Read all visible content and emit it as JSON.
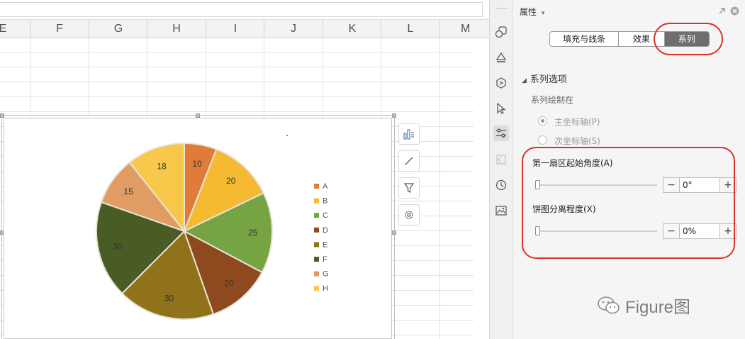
{
  "columns": [
    "E",
    "F",
    "G",
    "H",
    "I",
    "J",
    "K",
    "L",
    "M"
  ],
  "chart_data": {
    "type": "pie",
    "labels": [
      "A",
      "B",
      "C",
      "D",
      "E",
      "F",
      "G",
      "H"
    ],
    "values": [
      10,
      20,
      25,
      20,
      30,
      30,
      15,
      18
    ],
    "data_labels": [
      "10",
      "20",
      "25",
      "20",
      "30",
      "30",
      "15",
      "18"
    ],
    "colors": [
      "#e07b39",
      "#f5ba32",
      "#77a443",
      "#8e4a1e",
      "#8f7219",
      "#4a5c26",
      "#e09c63",
      "#f7c84a"
    ],
    "legend_position": "right",
    "start_angle_deg": 0
  },
  "chart_tools": [
    {
      "name": "chart-elements-icon"
    },
    {
      "name": "chart-style-icon"
    },
    {
      "name": "chart-filter-icon"
    },
    {
      "name": "chart-settings-icon"
    }
  ],
  "panel": {
    "title": "属性",
    "tabs": [
      "填充与线条",
      "效果",
      "系列"
    ],
    "selected_tab": "系列",
    "section_title": "系列选项",
    "plot_on_label": "系列绘制在",
    "primary_axis_label": "主坐标轴(P)",
    "secondary_axis_label": "次坐标轴(S)",
    "angle_label": "第一扇区起始角度(A)",
    "angle_value": "0°",
    "explosion_label": "饼图分离程度(X)",
    "explosion_value": "0%",
    "minus": "−",
    "plus": "+"
  },
  "watermark": "Figure图",
  "highlight_color": "#e0302b"
}
